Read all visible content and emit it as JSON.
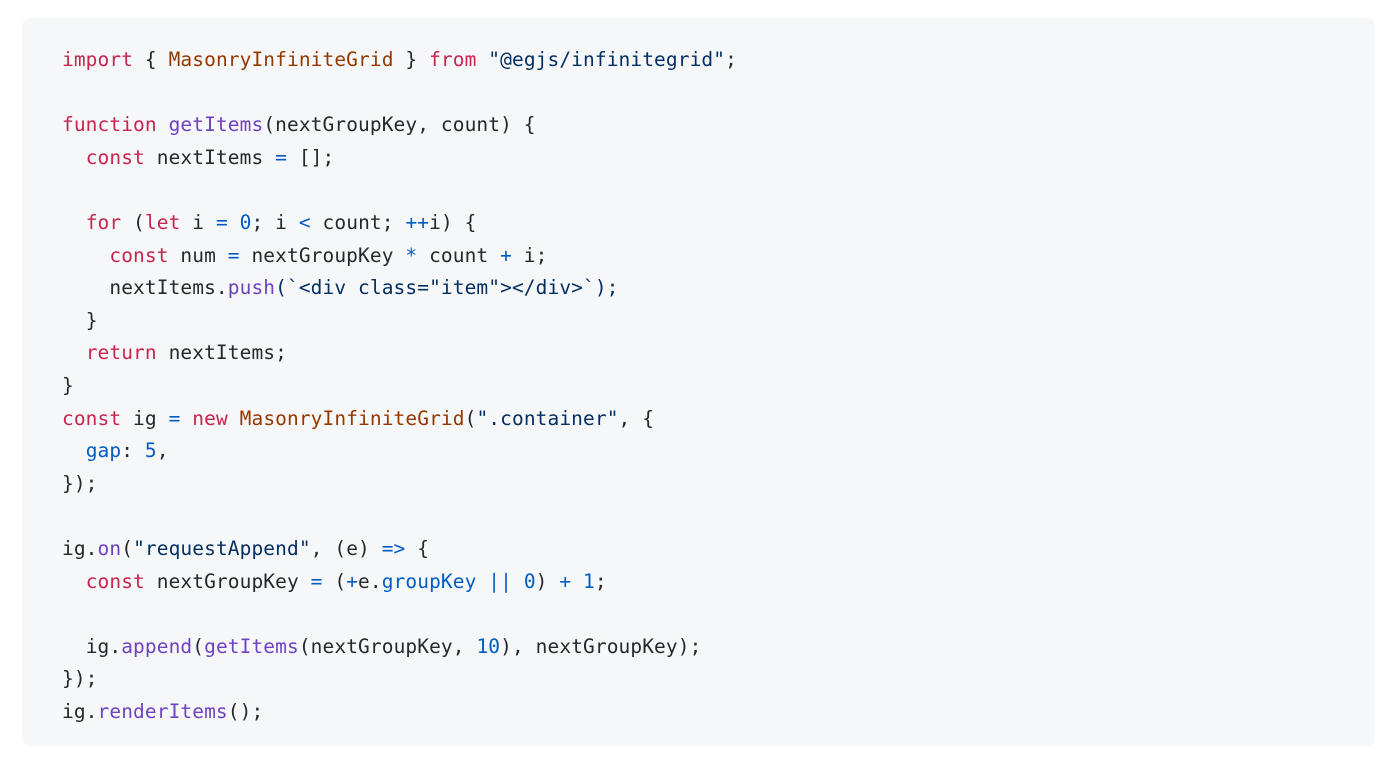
{
  "card": {
    "background": "#f6f7f9",
    "page_background": "#ffffff"
  },
  "theme": {
    "keyword": "#c7254e",
    "class_name": "#953800",
    "string": "#032f62",
    "function": "#6f42c1",
    "property": "#005cc5",
    "number": "#005cc5",
    "operator": "#005cc5",
    "plain": "#24292e"
  },
  "code": {
    "language": "javascript",
    "lines": [
      "import { MasonryInfiniteGrid } from \"@egjs/infinitegrid\";",
      "",
      "function getItems(nextGroupKey, count) {",
      "  const nextItems = [];",
      "",
      "  for (let i = 0; i < count; ++i) {",
      "    const num = nextGroupKey * count + i;",
      "    nextItems.push(`<div class=\"item\"></div>`);",
      "  }",
      "  return nextItems;",
      "}",
      "const ig = new MasonryInfiniteGrid(\".container\", {",
      "  gap: 5,",
      "});",
      "",
      "ig.on(\"requestAppend\", (e) => {",
      "  const nextGroupKey = (+e.groupKey || 0) + 1;",
      "",
      "  ig.append(getItems(nextGroupKey, 10), nextGroupKey);",
      "});",
      "ig.renderItems();"
    ],
    "line_1": {
      "kw_import": "import",
      "brace_open": " { ",
      "ident": "MasonryInfiniteGrid",
      "brace_close": " } ",
      "kw_from": "from",
      "space": " ",
      "module": "\"@egjs/infinitegrid\"",
      "semi": ";"
    },
    "line_3": {
      "kw": "function",
      "name": "getItems",
      "params": "(nextGroupKey, count) {"
    },
    "line_4": {
      "kw": "const",
      "name": " nextItems ",
      "op": "=",
      "rest": " [];"
    },
    "line_6": {
      "kw_for": "for",
      "paren": " (",
      "kw_let": "let",
      "i": " i ",
      "eq": "=",
      "zero": " 0",
      "semi1": "; i ",
      "lt": "<",
      "count": " count; ",
      "inc": "++",
      "tail": "i) {"
    },
    "line_7": {
      "kw": "const",
      "name": " num ",
      "eq": "=",
      "expr1": " nextGroupKey ",
      "mul": "*",
      "expr2": " count ",
      "plus": "+",
      "expr3": " i;"
    },
    "line_8": {
      "obj": "nextItems.",
      "method": "push",
      "args": "(`<div class=\"item\"></div>`);"
    },
    "line_9": {
      "text": "}"
    },
    "line_10": {
      "kw": "return",
      "rest": " nextItems;"
    },
    "line_11": {
      "text": "}"
    },
    "line_12": {
      "kw_const": "const",
      "ident": " ig ",
      "eq": "=",
      "kw_new": " new",
      "cls": " MasonryInfiniteGrid",
      "paren": "(",
      "str": "\".container\"",
      "tail": ", {"
    },
    "line_13": {
      "prop": "gap",
      "colon": ": ",
      "num": "5",
      "comma": ","
    },
    "line_14": {
      "text": "});"
    },
    "line_16": {
      "obj": "ig.",
      "method": "on",
      "paren": "(",
      "str": "\"requestAppend\"",
      "mid": ", (e) ",
      "arrow": "=>",
      "tail": " {"
    },
    "line_17": {
      "kw": "const",
      "name": " nextGroupKey ",
      "eq": "=",
      "open": " (",
      "plus": "+",
      "e": "e.",
      "prop": "groupKey",
      "or": " ||",
      "zero": " 0",
      "close": ") ",
      "plus2": "+",
      "one": " 1",
      "semi": ";"
    },
    "line_19": {
      "obj": "ig.",
      "method": "append",
      "paren": "(",
      "fn2": "getItems",
      "args": "(nextGroupKey, ",
      "num": "10",
      "tail": "), nextGroupKey);"
    },
    "line_20": {
      "text": "});"
    },
    "line_21": {
      "obj": "ig.",
      "method": "renderItems",
      "tail": "();"
    }
  }
}
